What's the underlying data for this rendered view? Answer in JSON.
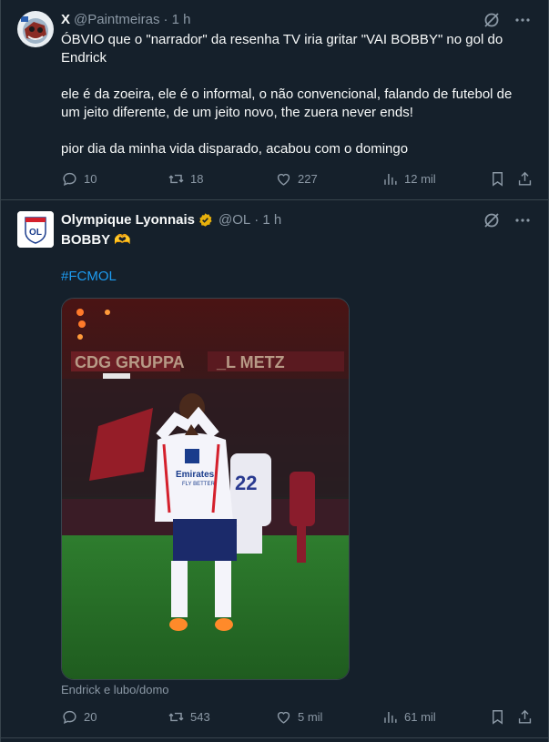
{
  "tweets": [
    {
      "author_name": "X",
      "handle": "@Paintmeiras",
      "time": "· 1 h",
      "lines": [
        "ÓBVIO que o \"narrador\" da resenha TV iria gritar \"VAI BOBBY\" no gol do Endrick",
        "ele é da zoeira, ele é o informal, o não convencional, falando de futebol de um jeito diferente, de um jeito novo, the zuera never ends!",
        "pior dia da minha vida disparado, acabou com o domingo"
      ],
      "replies": "10",
      "reposts": "18",
      "likes": "227",
      "views": "12 mil"
    },
    {
      "author_name": "Olympique Lyonnais",
      "handle": "@OL",
      "time": "· 1 h",
      "text": "BOBBY 🫶",
      "hashtag": "#FCMOL",
      "media_caption": "Endrick e lubo/domo",
      "replies": "20",
      "reposts": "543",
      "likes": "5 mil",
      "views": "61 mil"
    }
  ],
  "colors": {
    "background": "#15202b",
    "border": "#38444d",
    "text": "#f7f9f9",
    "muted": "#8b98a5",
    "link": "#1d9bf0",
    "verified_gold": "#e8b10c"
  },
  "icons": [
    "avatar",
    "verified-badge-icon",
    "grok-icon",
    "more-icon",
    "reply-icon",
    "repost-icon",
    "like-icon",
    "views-icon",
    "bookmark-icon",
    "share-icon"
  ]
}
